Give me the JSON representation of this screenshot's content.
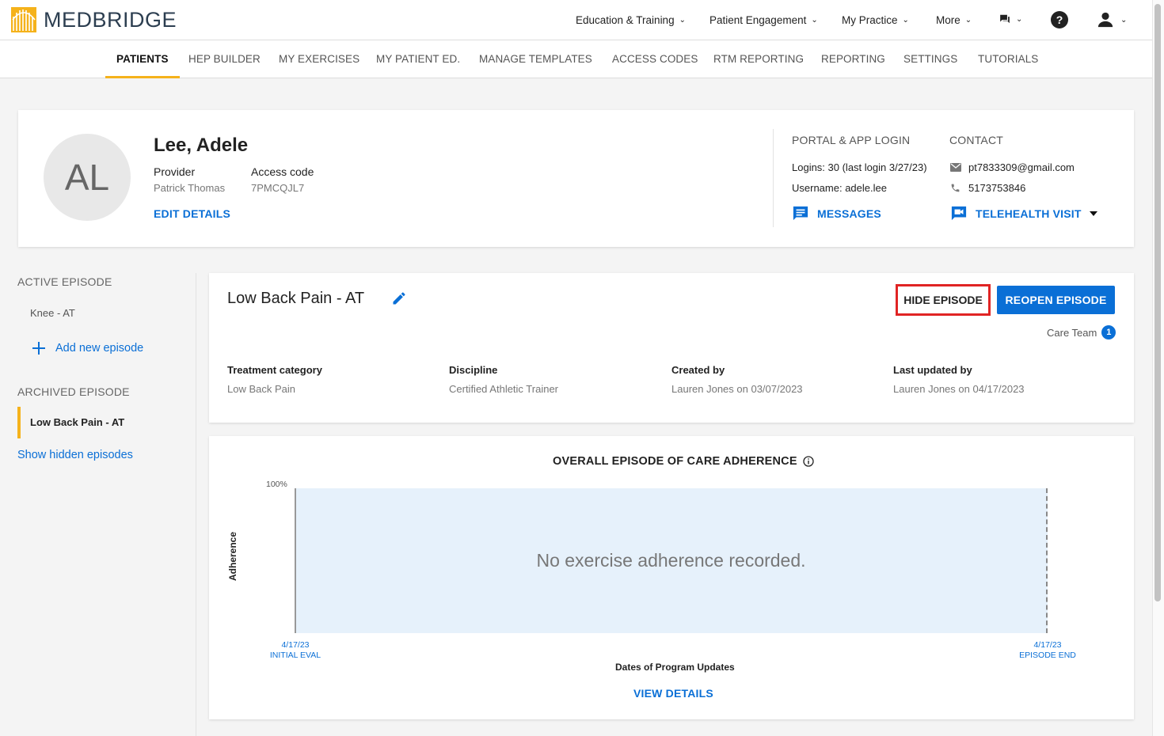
{
  "app": {
    "name": "MEDBRIDGE"
  },
  "top_nav": [
    {
      "label": "Education & Training"
    },
    {
      "label": "Patient Engagement"
    },
    {
      "label": "My Practice"
    },
    {
      "label": "More"
    }
  ],
  "sub_nav": [
    {
      "label": "PATIENTS",
      "active": true
    },
    {
      "label": "HEP BUILDER"
    },
    {
      "label": "MY EXERCISES"
    },
    {
      "label": "MY PATIENT ED."
    },
    {
      "label": "MANAGE TEMPLATES"
    },
    {
      "label": "ACCESS CODES"
    },
    {
      "label": "RTM REPORTING"
    },
    {
      "label": "REPORTING"
    },
    {
      "label": "SETTINGS"
    },
    {
      "label": "TUTORIALS"
    }
  ],
  "patient": {
    "initials": "AL",
    "name": "Lee, Adele",
    "provider_label": "Provider",
    "provider": "Patrick Thomas",
    "access_code_label": "Access code",
    "access_code": "7PMCQJL7",
    "edit_label": "EDIT DETAILS",
    "portal_title": "PORTAL & APP LOGIN",
    "logins": "Logins: 30 (last login 3/27/23)",
    "username": "Username: adele.lee",
    "messages_label": "MESSAGES",
    "contact_title": "CONTACT",
    "email": "pt7833309@gmail.com",
    "phone": "5173753846",
    "telehealth_label": "TELEHEALTH VISIT"
  },
  "sidebar": {
    "active_title": "ACTIVE EPISODE",
    "active_items": [
      "Knee - AT"
    ],
    "add_label": "Add new episode",
    "archived_title": "ARCHIVED EPISODE",
    "archived_items": [
      "Low Back Pain - AT"
    ],
    "show_hidden_label": "Show hidden episodes"
  },
  "episode": {
    "title": "Low Back Pain - AT",
    "hide_label": "HIDE EPISODE",
    "reopen_label": "REOPEN EPISODE",
    "care_team_label": "Care Team",
    "care_team_count": "1",
    "fields": [
      {
        "label": "Treatment category",
        "value": "Low Back Pain"
      },
      {
        "label": "Discipline",
        "value": "Certified Athletic Trainer"
      },
      {
        "label": "Created by",
        "value": "Lauren Jones on 03/07/2023"
      },
      {
        "label": "Last updated by",
        "value": "Lauren Jones on 04/17/2023"
      }
    ]
  },
  "chart_data": {
    "type": "area",
    "title": "OVERALL EPISODE OF CARE ADHERENCE",
    "ylabel": "Adherence",
    "xlabel": "Dates of Program Updates",
    "y_tick": "100%",
    "x_ticks": [
      {
        "date": "4/17/23",
        "label": "INITIAL EVAL"
      },
      {
        "date": "4/17/23",
        "label": "EPISODE END"
      }
    ],
    "series": [],
    "empty_message": "No exercise adherence recorded.",
    "view_details_label": "VIEW DETAILS"
  },
  "colors": {
    "accent": "#0a6fd6",
    "brand_yellow": "#f5b21b",
    "highlight": "#e02424"
  }
}
